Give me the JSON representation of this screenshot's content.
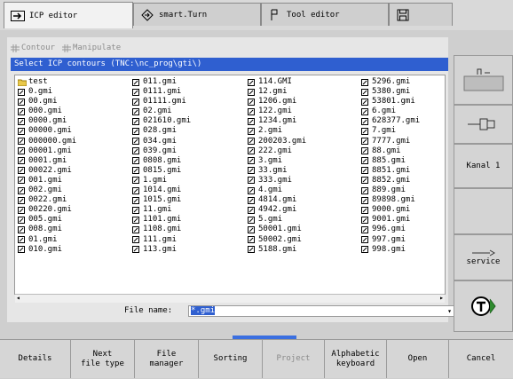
{
  "tabs": [
    {
      "label": "ICP editor",
      "icon": "arrow-right-icon"
    },
    {
      "label": "smart.Turn",
      "icon": "diamond-arrow-icon"
    },
    {
      "label": "Tool editor",
      "icon": "tool-icon"
    },
    {
      "label": "",
      "icon": "save-disk-icon"
    }
  ],
  "menu": {
    "contour": "Contour",
    "manipulate": "Manipulate"
  },
  "dialog_title": "Select ICP contours  (TNC:\\nc_prog\\gti\\)",
  "columns": [
    [
      "test",
      "0.gmi",
      "00.gmi",
      "000.gmi",
      "0000.gmi",
      "00000.gmi",
      "000000.gmi",
      "00001.gmi",
      "0001.gmi",
      "00022.gmi",
      "001.gmi",
      "002.gmi",
      "0022.gmi",
      "00220.gmi",
      "005.gmi",
      "008.gmi",
      "01.gmi",
      "010.gmi"
    ],
    [
      "011.gmi",
      "0111.gmi",
      "01111.gmi",
      "02.gmi",
      "021610.gmi",
      "028.gmi",
      "034.gmi",
      "039.gmi",
      "0808.gmi",
      "0815.gmi",
      "1.gmi",
      "1014.gmi",
      "1015.gmi",
      "11.gmi",
      "1101.gmi",
      "1108.gmi",
      "111.gmi",
      "113.gmi"
    ],
    [
      "114.GMI",
      "12.gmi",
      "1206.gmi",
      "122.gmi",
      "1234.gmi",
      "2.gmi",
      "200203.gmi",
      "222.gmi",
      "3.gmi",
      "33.gmi",
      "333.gmi",
      "4.gmi",
      "4814.gmi",
      "4942.gmi",
      "5.gmi",
      "50001.gmi",
      "50002.gmi",
      "5188.gmi"
    ],
    [
      "5296.gmi",
      "5380.gmi",
      "53801.gmi",
      "6.gmi",
      "628377.gmi",
      "7.gmi",
      "7777.gmi",
      "88.gmi",
      "885.gmi",
      "8851.gmi",
      "8852.gmi",
      "889.gmi",
      "89898.gmi",
      "9000.gmi",
      "9001.gmi",
      "996.gmi",
      "997.gmi",
      "998.gmi"
    ]
  ],
  "filename": {
    "label": "File name:",
    "value": "*.gmi"
  },
  "right_keys": {
    "kanal": "Kanal 1",
    "service": "service"
  },
  "bottom_keys": [
    "Details",
    "Next\nfile type",
    "File\nmanager",
    "Sorting",
    "Project",
    "Alphabetic\nkeyboard",
    "Open",
    "Cancel"
  ]
}
